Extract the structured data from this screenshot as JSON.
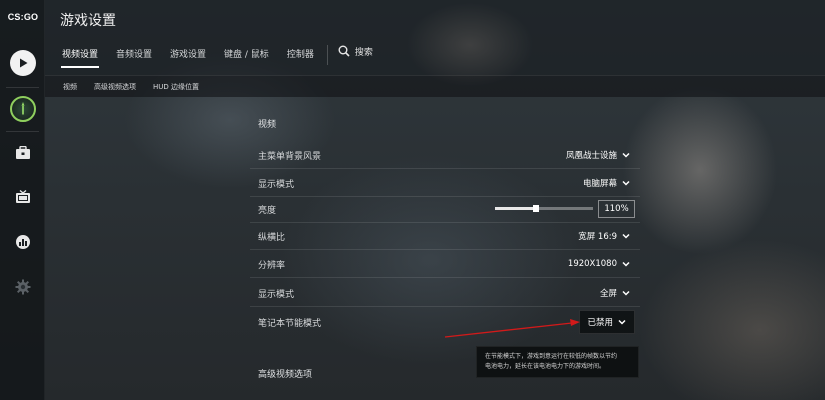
{
  "app": {
    "logo_text": "CS:GO"
  },
  "rail": {
    "items": [
      {
        "name": "play-icon"
      },
      {
        "name": "rank-icon"
      },
      {
        "name": "inventory-icon"
      },
      {
        "name": "watch-icon"
      },
      {
        "name": "stats-icon"
      },
      {
        "name": "gear-icon"
      }
    ]
  },
  "header": {
    "title": "游戏设置",
    "tabs": [
      {
        "label": "视频设置",
        "active": true
      },
      {
        "label": "音频设置",
        "active": false
      },
      {
        "label": "游戏设置",
        "active": false
      },
      {
        "label": "键盘 / 鼠标",
        "active": false
      },
      {
        "label": "控制器",
        "active": false
      }
    ],
    "search_label": "搜索"
  },
  "subnav": {
    "items": [
      "视频",
      "高级视频选项",
      "HUD 边缘位置"
    ]
  },
  "video": {
    "section_title": "视频",
    "rows": [
      {
        "label": "主菜单背景风景",
        "value": "凤凰战士设施"
      },
      {
        "label": "显示模式",
        "value": "电脑屏幕"
      },
      {
        "label": "亮度",
        "value": "110%",
        "slider_fraction": 0.42
      },
      {
        "label": "纵横比",
        "value": "宽屏 16:9"
      },
      {
        "label": "分辨率",
        "value": "1920X1080"
      },
      {
        "label": "显示模式",
        "value": "全屏"
      },
      {
        "label": "笔记本节能模式",
        "value": "已禁用"
      }
    ],
    "advanced_title": "高级视频选项"
  },
  "tooltip": {
    "line1": "在节能模式下，游戏到意运行在较低的帧数以节约",
    "line2": "电池电力，延长在该电池电力下的游戏时间。"
  },
  "colors": {
    "annotation_arrow": "#d21a1a"
  }
}
